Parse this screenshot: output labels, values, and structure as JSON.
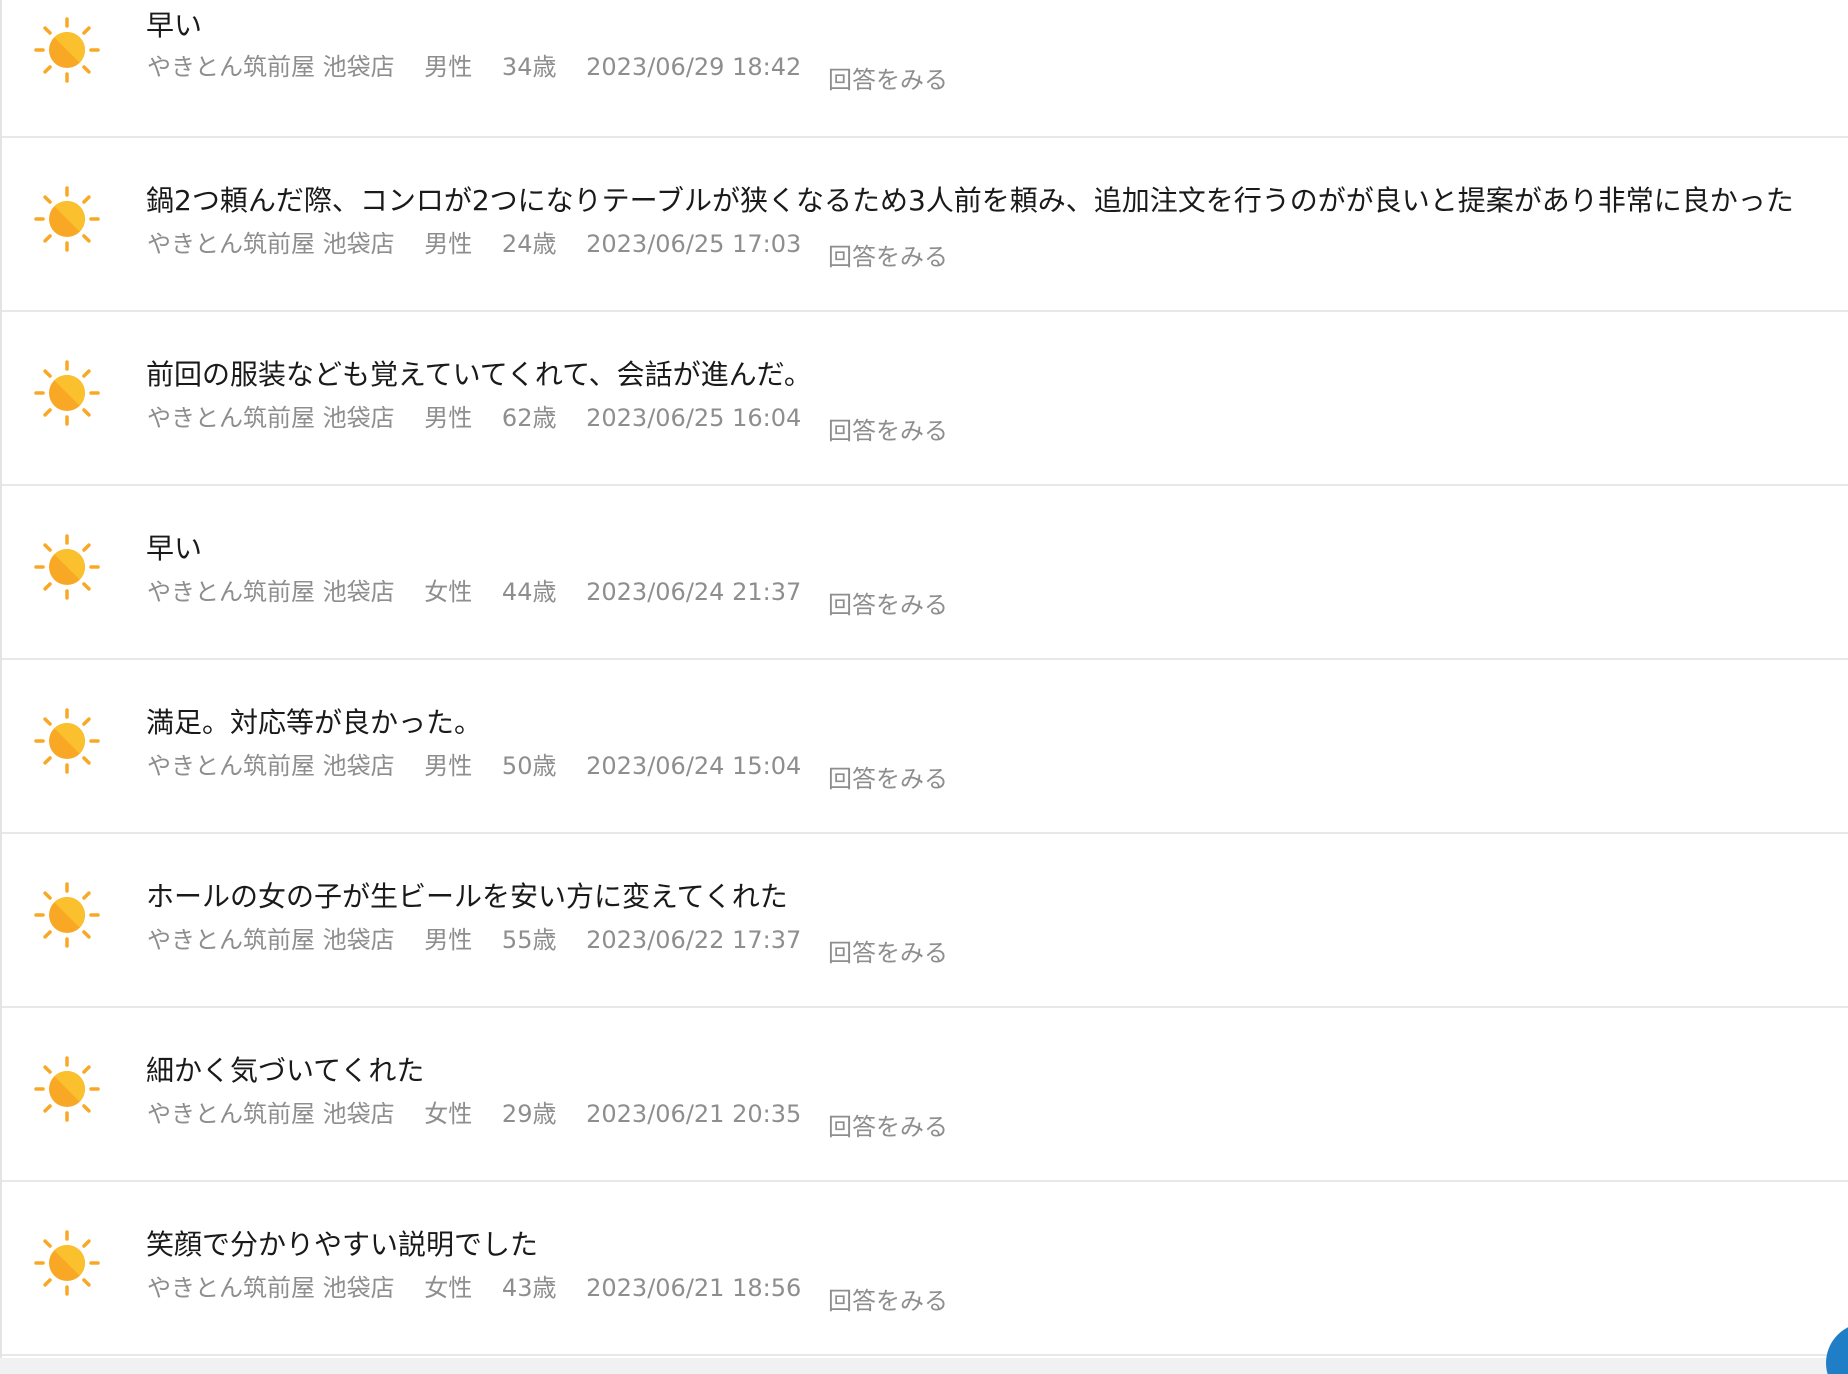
{
  "colors": {
    "sun_primary": "#f9a825",
    "sun_secondary": "#fbc02d",
    "meta_text": "#8e8e8e",
    "comment_text": "#1a1a1a",
    "fab": "#1f7ec5"
  },
  "items": [
    {
      "comment": "早い",
      "store": "やきとん筑前屋 池袋店",
      "gender": "男性",
      "age": "34歳",
      "datetime": "2023/06/29 18:42",
      "answer_label": "回答をみる",
      "icon": "sun-icon"
    },
    {
      "comment": "鍋2つ頼んだ際、コンロが2つになりテーブルが狭くなるため3人前を頼み、追加注文を行うのがが良いと提案があり非常に良かった",
      "store": "やきとん筑前屋 池袋店",
      "gender": "男性",
      "age": "24歳",
      "datetime": "2023/06/25 17:03",
      "answer_label": "回答をみる",
      "icon": "sun-icon"
    },
    {
      "comment": "前回の服装なども覚えていてくれて、会話が進んだ。",
      "store": "やきとん筑前屋 池袋店",
      "gender": "男性",
      "age": "62歳",
      "datetime": "2023/06/25 16:04",
      "answer_label": "回答をみる",
      "icon": "sun-icon"
    },
    {
      "comment": "早い",
      "store": "やきとん筑前屋 池袋店",
      "gender": "女性",
      "age": "44歳",
      "datetime": "2023/06/24 21:37",
      "answer_label": "回答をみる",
      "icon": "sun-icon"
    },
    {
      "comment": "満足。対応等が良かった。",
      "store": "やきとん筑前屋 池袋店",
      "gender": "男性",
      "age": "50歳",
      "datetime": "2023/06/24 15:04",
      "answer_label": "回答をみる",
      "icon": "sun-icon"
    },
    {
      "comment": "ホールの女の子が生ビールを安い方に変えてくれた",
      "store": "やきとん筑前屋 池袋店",
      "gender": "男性",
      "age": "55歳",
      "datetime": "2023/06/22 17:37",
      "answer_label": "回答をみる",
      "icon": "sun-icon"
    },
    {
      "comment": "細かく気づいてくれた",
      "store": "やきとん筑前屋 池袋店",
      "gender": "女性",
      "age": "29歳",
      "datetime": "2023/06/21 20:35",
      "answer_label": "回答をみる",
      "icon": "sun-icon"
    },
    {
      "comment": "笑顔で分かりやすい説明でした",
      "store": "やきとん筑前屋 池袋店",
      "gender": "女性",
      "age": "43歳",
      "datetime": "2023/06/21 18:56",
      "answer_label": "回答をみる",
      "icon": "sun-icon"
    }
  ]
}
